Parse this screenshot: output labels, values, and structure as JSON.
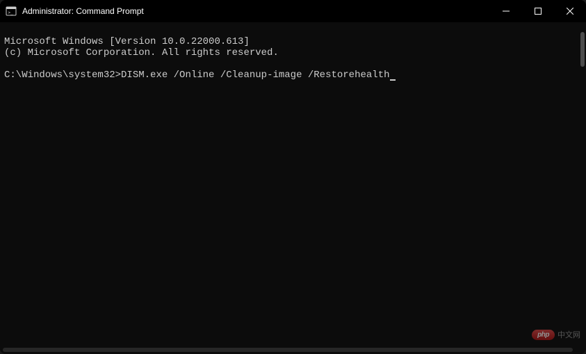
{
  "window": {
    "title": "Administrator: Command Prompt"
  },
  "terminal": {
    "line1": "Microsoft Windows [Version 10.0.22000.613]",
    "line2": "(c) Microsoft Corporation. All rights reserved.",
    "blank": "",
    "prompt": "C:\\Windows\\system32>",
    "command": "DISM.exe /Online /Cleanup-image /Restorehealth"
  },
  "watermark": {
    "pill": "php",
    "text": "中文网"
  }
}
